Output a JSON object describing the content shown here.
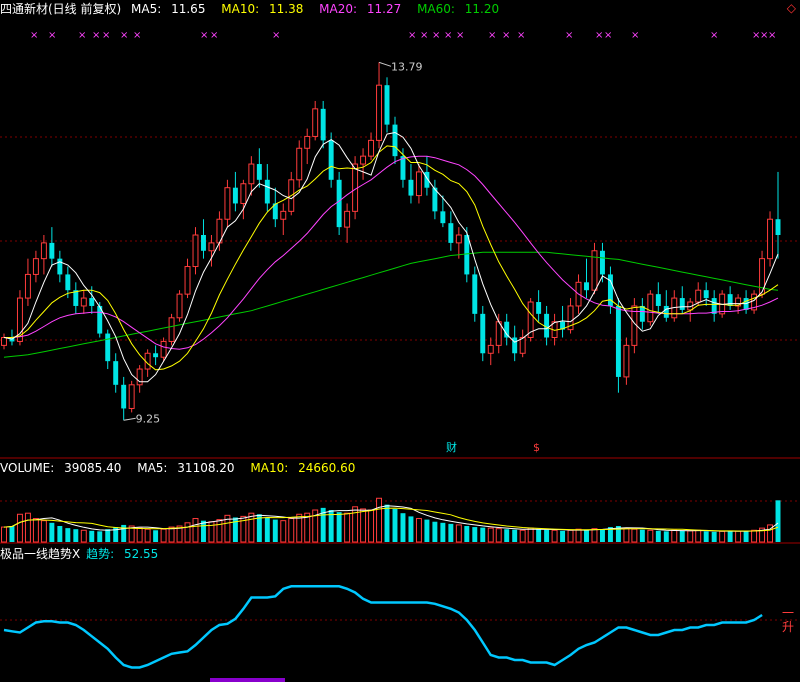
{
  "header": {
    "stock_name": "四通新材(日线 前复权)",
    "ma5_label": "MA5:",
    "ma5_value": "11.65",
    "ma10_label": "MA10:",
    "ma10_value": "11.38",
    "ma20_label": "MA20:",
    "ma20_value": "11.27",
    "ma60_label": "MA60:",
    "ma60_value": "11.20",
    "corner_icon": "diamond-icon"
  },
  "volume_header": {
    "label": "VOLUME:",
    "value": "39085.40",
    "ma5_label": "MA5:",
    "ma5_value": "31108.20",
    "ma10_label": "MA10:",
    "ma10_value": "24660.60"
  },
  "indicator_header": {
    "name": "极品一线趋势X",
    "trend_label": "趋势:",
    "trend_value": "52.55",
    "end_label": "一升"
  },
  "markers": {
    "finance": "财",
    "dollar": "$"
  },
  "colors": {
    "up": "#ff3c3c",
    "down": "#00e5e5",
    "ma5": "#ffffff",
    "ma10": "#ffff00",
    "ma20": "#ff44ff",
    "ma60": "#00cc00",
    "trend": "#00c8ff",
    "grid": "#800000",
    "x_marker": "#ff44ff"
  },
  "chart_data": {
    "type": "candlestick",
    "price_annotations": {
      "high": "13.79",
      "low": "9.25"
    },
    "price_range": [
      9.0,
      14.2
    ],
    "volume_range": [
      0,
      60000
    ],
    "trend_range": [
      0,
      100
    ],
    "candles": [
      [
        10.2,
        10.35,
        10.15,
        10.3
      ],
      [
        10.3,
        10.4,
        10.2,
        10.25
      ],
      [
        10.25,
        10.9,
        10.2,
        10.8
      ],
      [
        10.8,
        11.3,
        10.7,
        11.1
      ],
      [
        11.1,
        11.4,
        11.0,
        11.3
      ],
      [
        11.3,
        11.6,
        11.1,
        11.5
      ],
      [
        11.5,
        11.7,
        11.2,
        11.3
      ],
      [
        11.3,
        11.4,
        11.0,
        11.1
      ],
      [
        11.1,
        11.2,
        10.8,
        10.9
      ],
      [
        10.9,
        11.0,
        10.6,
        10.7
      ],
      [
        10.7,
        10.9,
        10.6,
        10.8
      ],
      [
        10.8,
        10.95,
        10.6,
        10.7
      ],
      [
        10.7,
        10.75,
        10.3,
        10.35
      ],
      [
        10.35,
        10.4,
        9.9,
        10.0
      ],
      [
        10.0,
        10.1,
        9.6,
        9.7
      ],
      [
        9.7,
        9.8,
        9.25,
        9.4
      ],
      [
        9.4,
        9.75,
        9.35,
        9.7
      ],
      [
        9.7,
        9.95,
        9.6,
        9.9
      ],
      [
        9.9,
        10.15,
        9.8,
        10.1
      ],
      [
        10.1,
        10.2,
        9.95,
        10.05
      ],
      [
        10.05,
        10.3,
        10.0,
        10.25
      ],
      [
        10.25,
        10.6,
        10.2,
        10.55
      ],
      [
        10.55,
        10.9,
        10.5,
        10.85
      ],
      [
        10.85,
        11.3,
        10.8,
        11.2
      ],
      [
        11.2,
        11.7,
        11.1,
        11.6
      ],
      [
        11.6,
        11.8,
        11.3,
        11.4
      ],
      [
        11.4,
        11.6,
        11.2,
        11.5
      ],
      [
        11.5,
        11.9,
        11.4,
        11.8
      ],
      [
        11.8,
        12.3,
        11.7,
        12.2
      ],
      [
        12.2,
        12.4,
        11.9,
        12.0
      ],
      [
        12.0,
        12.3,
        11.8,
        12.25
      ],
      [
        12.25,
        12.6,
        12.1,
        12.5
      ],
      [
        12.5,
        12.7,
        12.2,
        12.3
      ],
      [
        12.3,
        12.5,
        11.9,
        12.0
      ],
      [
        12.0,
        12.2,
        11.7,
        11.8
      ],
      [
        11.8,
        12.0,
        11.6,
        11.9
      ],
      [
        11.9,
        12.4,
        11.85,
        12.3
      ],
      [
        12.3,
        12.8,
        12.2,
        12.7
      ],
      [
        12.7,
        12.95,
        12.5,
        12.85
      ],
      [
        12.85,
        13.3,
        12.8,
        13.2
      ],
      [
        13.2,
        13.3,
        12.7,
        12.8
      ],
      [
        12.8,
        12.9,
        12.2,
        12.3
      ],
      [
        12.3,
        12.4,
        11.6,
        11.7
      ],
      [
        11.7,
        12.0,
        11.5,
        11.9
      ],
      [
        11.9,
        12.6,
        11.8,
        12.5
      ],
      [
        12.5,
        12.7,
        12.3,
        12.6
      ],
      [
        12.6,
        12.9,
        12.55,
        12.8
      ],
      [
        12.8,
        13.79,
        12.7,
        13.5
      ],
      [
        13.5,
        13.6,
        12.9,
        13.0
      ],
      [
        13.0,
        13.1,
        12.5,
        12.6
      ],
      [
        12.6,
        12.7,
        12.2,
        12.3
      ],
      [
        12.3,
        12.5,
        12.0,
        12.1
      ],
      [
        12.1,
        12.5,
        12.0,
        12.4
      ],
      [
        12.4,
        12.6,
        12.1,
        12.2
      ],
      [
        12.2,
        12.3,
        11.8,
        11.9
      ],
      [
        11.9,
        12.1,
        11.7,
        11.75
      ],
      [
        11.75,
        11.9,
        11.4,
        11.5
      ],
      [
        11.5,
        11.7,
        11.3,
        11.6
      ],
      [
        11.6,
        11.7,
        11.0,
        11.1
      ],
      [
        11.1,
        11.2,
        10.5,
        10.6
      ],
      [
        10.6,
        10.7,
        10.0,
        10.1
      ],
      [
        10.1,
        10.3,
        9.95,
        10.2
      ],
      [
        10.2,
        10.6,
        10.1,
        10.5
      ],
      [
        10.5,
        10.6,
        10.2,
        10.3
      ],
      [
        10.3,
        10.45,
        10.0,
        10.1
      ],
      [
        10.1,
        10.4,
        10.05,
        10.3
      ],
      [
        10.3,
        10.8,
        10.25,
        10.75
      ],
      [
        10.75,
        10.9,
        10.5,
        10.6
      ],
      [
        10.6,
        10.7,
        10.2,
        10.3
      ],
      [
        10.3,
        10.6,
        10.2,
        10.5
      ],
      [
        10.5,
        10.7,
        10.3,
        10.4
      ],
      [
        10.4,
        10.8,
        10.35,
        10.7
      ],
      [
        10.7,
        11.1,
        10.6,
        11.0
      ],
      [
        11.0,
        11.3,
        10.8,
        10.9
      ],
      [
        10.9,
        11.5,
        10.85,
        11.4
      ],
      [
        11.4,
        11.5,
        11.0,
        11.1
      ],
      [
        11.1,
        11.2,
        10.6,
        10.7
      ],
      [
        10.7,
        10.8,
        9.6,
        9.8
      ],
      [
        9.8,
        10.3,
        9.7,
        10.2
      ],
      [
        10.2,
        10.8,
        10.1,
        10.7
      ],
      [
        10.7,
        10.8,
        10.4,
        10.5
      ],
      [
        10.5,
        10.9,
        10.45,
        10.85
      ],
      [
        10.85,
        11.0,
        10.6,
        10.7
      ],
      [
        10.7,
        10.9,
        10.5,
        10.55
      ],
      [
        10.55,
        10.9,
        10.5,
        10.8
      ],
      [
        10.8,
        10.95,
        10.6,
        10.65
      ],
      [
        10.65,
        10.8,
        10.5,
        10.75
      ],
      [
        10.75,
        11.0,
        10.7,
        10.9
      ],
      [
        10.9,
        11.0,
        10.7,
        10.8
      ],
      [
        10.8,
        10.9,
        10.5,
        10.6
      ],
      [
        10.6,
        10.9,
        10.55,
        10.85
      ],
      [
        10.85,
        10.95,
        10.65,
        10.7
      ],
      [
        10.7,
        10.85,
        10.6,
        10.8
      ],
      [
        10.8,
        10.9,
        10.6,
        10.65
      ],
      [
        10.65,
        10.9,
        10.6,
        10.85
      ],
      [
        10.85,
        11.4,
        10.8,
        11.3
      ],
      [
        11.3,
        11.9,
        11.2,
        11.8
      ],
      [
        11.8,
        12.4,
        11.3,
        11.6
      ]
    ],
    "volumes": [
      14000,
      15000,
      26000,
      27000,
      22000,
      20000,
      18000,
      15000,
      13000,
      12000,
      11000,
      10500,
      10000,
      12000,
      14000,
      16000,
      15000,
      13000,
      12000,
      11000,
      12000,
      14000,
      15000,
      18000,
      22000,
      20000,
      19000,
      21000,
      25000,
      23000,
      24000,
      27000,
      26000,
      23000,
      21000,
      20000,
      22000,
      26000,
      27000,
      30000,
      32000,
      30000,
      28000,
      27000,
      33000,
      31000,
      30000,
      41000,
      35000,
      31000,
      27000,
      24000,
      22000,
      21000,
      19000,
      18000,
      17000,
      16000,
      15000,
      14000,
      13500,
      13000,
      12500,
      12000,
      11500,
      11000,
      13000,
      12000,
      11500,
      11000,
      10500,
      11000,
      12000,
      11500,
      12500,
      12000,
      14000,
      15000,
      13000,
      12000,
      11500,
      11000,
      10500,
      10000,
      11000,
      10800,
      10500,
      11000,
      10000,
      9500,
      10000,
      10500,
      10200,
      10000,
      11000,
      13000,
      16000,
      39085
    ],
    "ma5": [
      10.3,
      10.28,
      10.35,
      10.48,
      10.75,
      11.0,
      11.22,
      11.26,
      11.22,
      11.12,
      10.96,
      10.84,
      10.69,
      10.51,
      10.31,
      10.03,
      9.83,
      9.74,
      9.74,
      9.83,
      10.0,
      10.17,
      10.35,
      10.59,
      10.89,
      11.13,
      11.31,
      11.5,
      11.7,
      11.78,
      11.93,
      12.15,
      12.25,
      12.21,
      12.17,
      12.1,
      12.06,
      12.14,
      12.31,
      12.59,
      12.75,
      12.81,
      12.74,
      12.58,
      12.44,
      12.4,
      12.36,
      12.66,
      12.88,
      12.9,
      12.84,
      12.7,
      12.48,
      12.32,
      12.18,
      12.07,
      11.95,
      11.76,
      11.63,
      11.29,
      10.98,
      10.72,
      10.5,
      10.34,
      10.24,
      10.29,
      10.37,
      10.41,
      10.41,
      10.49,
      10.51,
      10.5,
      10.58,
      10.7,
      10.88,
      11.08,
      11.02,
      10.78,
      10.62,
      10.48,
      10.38,
      10.41,
      10.58,
      10.66,
      10.68,
      10.69,
      10.69,
      10.74,
      10.78,
      10.74,
      10.72,
      10.73,
      10.73,
      10.73,
      10.77,
      10.88,
      11.11,
      11.36
    ],
    "ma10": [
      10.3,
      10.3,
      10.32,
      10.4,
      10.52,
      10.63,
      10.74,
      10.81,
      10.86,
      10.88,
      10.9,
      10.9,
      10.87,
      10.77,
      10.6,
      10.4,
      10.22,
      10.08,
      9.97,
      9.89,
      9.9,
      9.94,
      10.0,
      10.1,
      10.25,
      10.41,
      10.61,
      10.84,
      11.04,
      11.23,
      11.41,
      11.58,
      11.75,
      11.89,
      11.99,
      12.04,
      12.1,
      12.17,
      12.22,
      12.31,
      12.41,
      12.47,
      12.44,
      12.45,
      12.44,
      12.46,
      12.52,
      12.65,
      12.73,
      12.72,
      12.62,
      12.52,
      12.52,
      12.49,
      12.42,
      12.37,
      12.29,
      12.25,
      12.15,
      11.98,
      11.71,
      11.48,
      11.26,
      11.08,
      10.91,
      10.73,
      10.6,
      10.49,
      10.43,
      10.39,
      10.41,
      10.45,
      10.49,
      10.55,
      10.64,
      10.76,
      10.78,
      10.7,
      10.66,
      10.68,
      10.69,
      10.64,
      10.62,
      10.6,
      10.6,
      10.6,
      10.64,
      10.71,
      10.72,
      10.72,
      10.72,
      10.71,
      10.71,
      10.76,
      10.8,
      10.84,
      10.9,
      10.97
    ],
    "ma20": [
      10.3,
      10.3,
      10.31,
      10.33,
      10.38,
      10.44,
      10.5,
      10.55,
      10.58,
      10.6,
      10.61,
      10.62,
      10.62,
      10.6,
      10.56,
      10.5,
      10.43,
      10.36,
      10.29,
      10.22,
      10.18,
      10.16,
      10.15,
      10.17,
      10.21,
      10.28,
      10.36,
      10.45,
      10.55,
      10.67,
      10.79,
      10.92,
      11.05,
      11.16,
      11.26,
      11.34,
      11.43,
      11.52,
      11.62,
      11.74,
      11.86,
      11.96,
      12.03,
      12.11,
      12.18,
      12.24,
      12.3,
      12.38,
      12.46,
      12.53,
      12.57,
      12.59,
      12.6,
      12.6,
      12.58,
      12.55,
      12.52,
      12.49,
      12.43,
      12.35,
      12.24,
      12.12,
      12.0,
      11.88,
      11.76,
      11.63,
      11.5,
      11.37,
      11.25,
      11.14,
      11.03,
      10.94,
      10.85,
      10.79,
      10.74,
      10.71,
      10.7,
      10.66,
      10.64,
      10.63,
      10.63,
      10.62,
      10.61,
      10.6,
      10.6,
      10.6,
      10.6,
      10.61,
      10.61,
      10.62,
      10.63,
      10.63,
      10.64,
      10.66,
      10.68,
      10.71,
      10.75,
      10.8
    ],
    "ma60": [
      10.05,
      10.06,
      10.07,
      10.08,
      10.1,
      10.12,
      10.14,
      10.16,
      10.18,
      10.2,
      10.22,
      10.24,
      10.26,
      10.28,
      10.3,
      10.32,
      10.34,
      10.36,
      10.38,
      10.4,
      10.42,
      10.44,
      10.46,
      10.48,
      10.5,
      10.52,
      10.54,
      10.56,
      10.58,
      10.6,
      10.62,
      10.64,
      10.67,
      10.7,
      10.73,
      10.76,
      10.79,
      10.82,
      10.85,
      10.88,
      10.91,
      10.94,
      10.97,
      11.0,
      11.03,
      11.06,
      11.09,
      11.12,
      11.15,
      11.18,
      11.21,
      11.24,
      11.26,
      11.28,
      11.3,
      11.32,
      11.34,
      11.35,
      11.36,
      11.37,
      11.38,
      11.38,
      11.38,
      11.38,
      11.38,
      11.38,
      11.38,
      11.38,
      11.38,
      11.37,
      11.36,
      11.35,
      11.34,
      11.33,
      11.32,
      11.31,
      11.3,
      11.29,
      11.27,
      11.25,
      11.23,
      11.21,
      11.19,
      11.17,
      11.15,
      11.13,
      11.11,
      11.09,
      11.07,
      11.05,
      11.03,
      11.01,
      10.99,
      10.97,
      10.95,
      10.93,
      10.91,
      10.9
    ],
    "trend": [
      40,
      39,
      38,
      42,
      46,
      47,
      47,
      46,
      46,
      44,
      40,
      35,
      30,
      25,
      18,
      12,
      10,
      10,
      12,
      15,
      18,
      21,
      22,
      23,
      28,
      34,
      40,
      44,
      45,
      49,
      57,
      66,
      66,
      66,
      67,
      73,
      75,
      75,
      75,
      75,
      75,
      75,
      75,
      73,
      70,
      65,
      62,
      62,
      62,
      62,
      62,
      62,
      62,
      62,
      61,
      59,
      57,
      54,
      48,
      40,
      30,
      20,
      18,
      18,
      16,
      16,
      14,
      14,
      14,
      12,
      16,
      20,
      25,
      28,
      30,
      34,
      38,
      42,
      42,
      40,
      38,
      36,
      36,
      38,
      40,
      40,
      42,
      42,
      44,
      44,
      46,
      46,
      46,
      46,
      48,
      52
    ]
  }
}
